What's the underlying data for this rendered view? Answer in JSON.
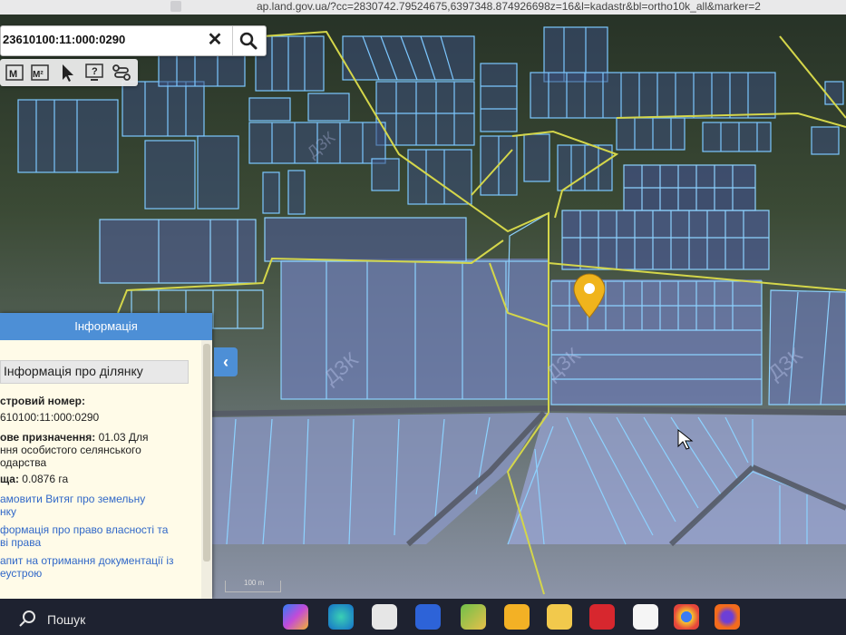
{
  "browser": {
    "url": "ap.land.gov.ua/?cc=2830742.79524675,6397348.874926698z=16&l=kadastr&bl=ortho10k_all&marker=2"
  },
  "search": {
    "value": "23610100:11:000:0290",
    "clear_icon": "close-icon",
    "search_icon": "search-icon"
  },
  "toolbar": {
    "tools": [
      {
        "name": "measure-length-icon",
        "label": "M"
      },
      {
        "name": "measure-area-icon",
        "label": "M²"
      },
      {
        "name": "pointer-icon"
      },
      {
        "name": "info-query-icon",
        "label": "?"
      },
      {
        "name": "route-icon"
      }
    ]
  },
  "info_panel": {
    "header": "Інформація",
    "section_title": "Інформація про ділянку",
    "cadastral_label": "стровий номер:",
    "cadastral_value": "610100:11:000:0290",
    "purpose_label": "ове призначення:",
    "purpose_value": " 01.03 Для",
    "purpose_line2": "ння особистого селянського",
    "purpose_line3": "одарства",
    "area_label": "ща:",
    "area_value": " 0.0876 га",
    "links": [
      "амовити Витяг про земельну",
      "нку",
      "формація про право власності та",
      "ві права",
      "апит на отримання документації із",
      "еустрою"
    ],
    "collapse_icon": "chevron-left-icon"
  },
  "map": {
    "scale_label": "100 m",
    "watermark": "ДЗК",
    "marker_icon": "location-pin-icon",
    "colors": {
      "parcel_outline": "#7cc7ff",
      "boundary": "#d4d64a",
      "marker": "#f0b41c",
      "panel_header": "#4d8fd6"
    }
  },
  "taskbar": {
    "search_label": "Пошук",
    "apps": [
      "copilot-icon",
      "edge-icon",
      "chrome-icon",
      "store-icon",
      "photos-icon",
      "teams-icon",
      "file-explorer-icon",
      "acrobat-icon",
      "office-icon",
      "chrome-alt-icon",
      "firefox-icon"
    ]
  }
}
